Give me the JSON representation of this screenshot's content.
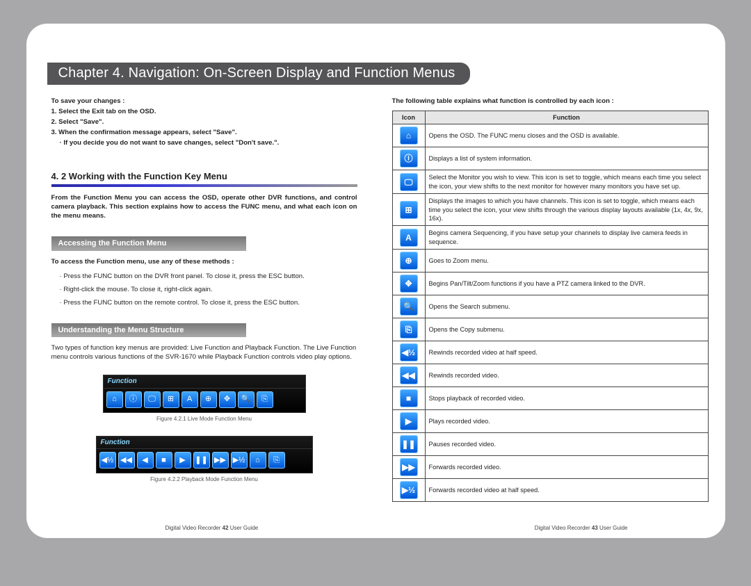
{
  "chapter_title": "Chapter 4. Navigation: On-Screen Display and Function Menus",
  "left": {
    "save_heading": "To save your changes :",
    "step1": "1. Select the Exit tab on the OSD.",
    "step2": "2. Select \"Save\".",
    "step3": "3. When the confirmation message appears, select \"Save\".",
    "step3_sub": "· If you decide you do not want to save changes, select \"Don't save.\".",
    "section_title": "4. 2 Working with the Function Key Menu",
    "intro": "From the Function Menu you can access the OSD, operate other DVR functions, and control camera playback. This section explains how to access the FUNC menu, and what each icon on the menu means.",
    "sub1_title": "Accessing the Function Menu",
    "sub1_lead": "To access the Function menu, use any of these methods :",
    "sub1_b1": "· Press the FUNC button on the DVR front panel. To close it, press the ESC button.",
    "sub1_b2": "· Right-click the mouse. To close it, right-click again.",
    "sub1_b3": "· Press the FUNC button on the remote control. To close it, press the ESC button.",
    "sub2_title": "Understanding the Menu Structure",
    "sub2_body": "Two types of function key menus are provided: Live Function and Playback Function. The Live Function menu controls various functions of the SVR-1670 while Playback Function controls video play options.",
    "fig1_title": "Function",
    "fig1_caption": "Figure 4.2.1 Live Mode Function Menu",
    "fig2_title": "Function",
    "fig2_caption": "Figure 4.2.2 Playback Mode Function Menu"
  },
  "right": {
    "lead": "The following table explains what function is controlled by each icon :",
    "headers": {
      "icon": "Icon",
      "func": "Function"
    },
    "rows": [
      {
        "glyph": "⌂",
        "name": "osd-icon",
        "text": "Opens the OSD. The FUNC menu closes and the OSD is available."
      },
      {
        "glyph": "ⓘ",
        "name": "info-icon",
        "text": "Displays a list of system information."
      },
      {
        "glyph": "🖵",
        "name": "monitor-icon",
        "text": "Select the Monitor you wish to view. This icon is set to toggle, which means each time you select the icon, your view shifts to the next monitor for however many monitors you have set up."
      },
      {
        "glyph": "⊞",
        "name": "grid-icon",
        "text": "Displays the images to which you have channels. This icon is set to toggle, which means each time you select the icon, your view shifts through the various display layouts available (1x, 4x, 9x, 16x)."
      },
      {
        "glyph": "A",
        "name": "sequence-icon",
        "text": "Begins camera Sequencing, if you have setup your channels to display live camera feeds in sequence."
      },
      {
        "glyph": "⊕",
        "name": "zoom-icon",
        "text": "Goes to Zoom menu."
      },
      {
        "glyph": "✥",
        "name": "ptz-icon",
        "text": "Begins Pan/Tilt/Zoom functions if you have a PTZ camera linked to the DVR."
      },
      {
        "glyph": "🔍",
        "name": "search-icon",
        "text": "Opens the Search submenu."
      },
      {
        "glyph": "⎘",
        "name": "copy-icon",
        "text": "Opens the Copy submenu."
      },
      {
        "glyph": "◀½",
        "name": "rewind-half-icon",
        "text": "Rewinds recorded video at half speed."
      },
      {
        "glyph": "◀◀",
        "name": "rewind-icon",
        "text": "Rewinds recorded video."
      },
      {
        "glyph": "■",
        "name": "stop-icon",
        "text": "Stops playback of recorded video."
      },
      {
        "glyph": "▶",
        "name": "play-icon",
        "text": "Plays recorded video."
      },
      {
        "glyph": "❚❚",
        "name": "pause-icon",
        "text": "Pauses recorded video."
      },
      {
        "glyph": "▶▶",
        "name": "forward-icon",
        "text": "Forwards recorded video."
      },
      {
        "glyph": "▶½",
        "name": "forward-half-icon",
        "text": "Forwards recorded video at half speed."
      }
    ]
  },
  "live_bar_icons": [
    "⌂",
    "ⓘ",
    "🖵",
    "⊞",
    "A",
    "⊕",
    "✥",
    "🔍",
    "⎘"
  ],
  "playback_bar_icons": [
    "◀½",
    "◀◀",
    "◀",
    "■",
    "▶",
    "❚❚",
    "▶▶",
    "▶½",
    "⌂",
    "⎘"
  ],
  "footer": {
    "lefttext": "Digital Video Recorder",
    "leftpage": "42",
    "guide": "User Guide",
    "rightpage": "43"
  }
}
